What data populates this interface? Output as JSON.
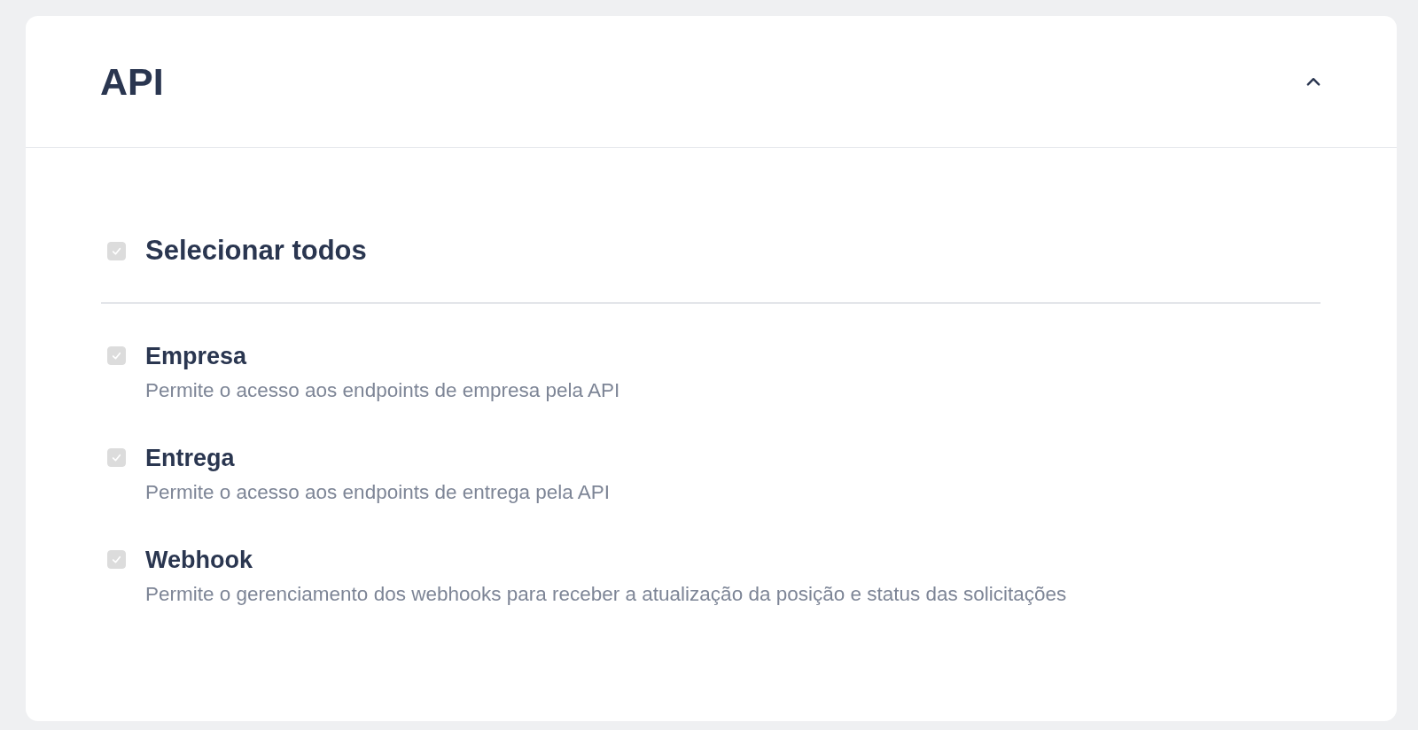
{
  "panel": {
    "title": "API",
    "expanded": true
  },
  "select_all": {
    "label": "Selecionar todos",
    "checked": true,
    "disabled": true
  },
  "permissions": [
    {
      "label": "Empresa",
      "description": "Permite o acesso aos endpoints de empresa pela API",
      "checked": true,
      "disabled": true
    },
    {
      "label": "Entrega",
      "description": "Permite o acesso aos endpoints de entrega pela API",
      "checked": true,
      "disabled": true
    },
    {
      "label": "Webhook",
      "description": "Permite o gerenciamento dos webhooks para receber a atualização da posição e status das solicitações",
      "checked": true,
      "disabled": true
    }
  ]
}
